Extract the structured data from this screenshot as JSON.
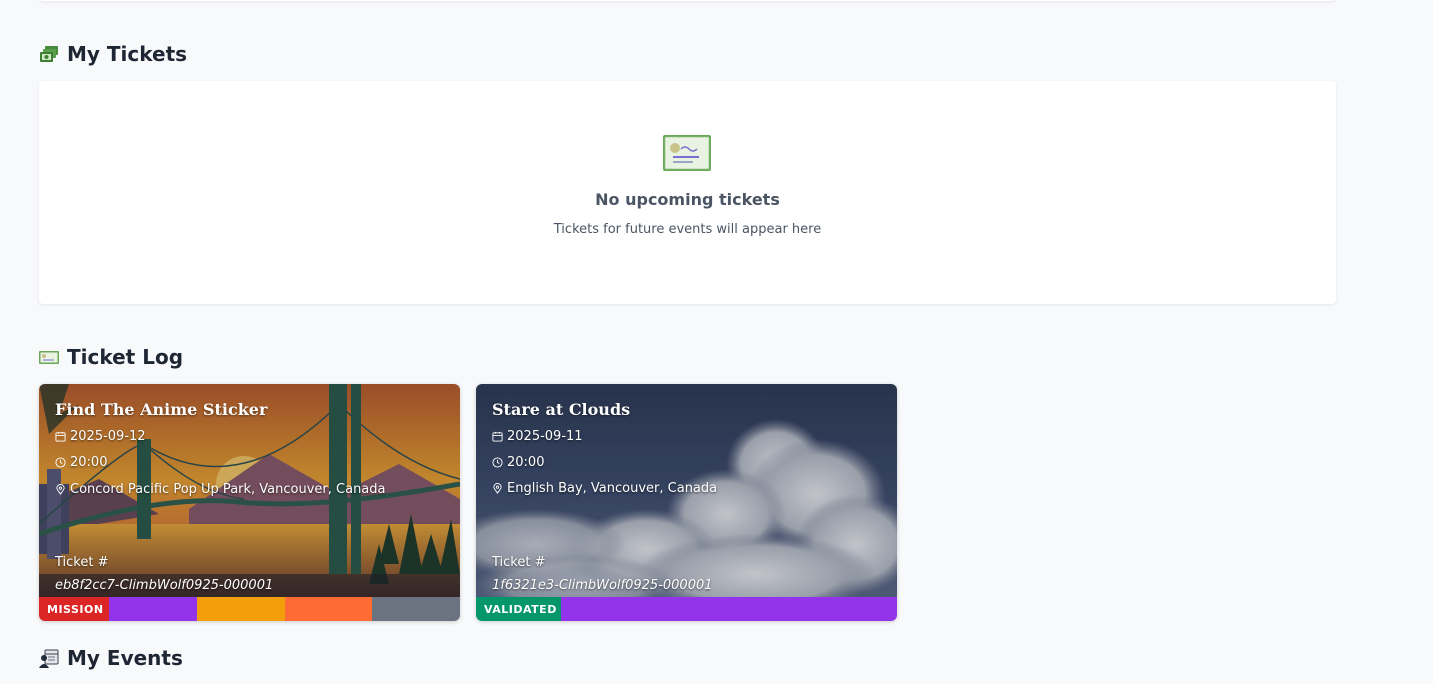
{
  "sections": {
    "my_tickets": {
      "title": "My Tickets",
      "icon": "tickets-stack-icon"
    },
    "ticket_log": {
      "title": "Ticket Log",
      "icon": "ticket-icon"
    },
    "my_events": {
      "title": "My Events",
      "icon": "calendar-person-icon"
    }
  },
  "empty_state": {
    "icon": "ticket-icon",
    "title": "No upcoming tickets",
    "subtitle": "Tickets for future events will appear here"
  },
  "ticket_log": [
    {
      "title": "Find The Anime Sticker",
      "date": "2025-09-12",
      "time": "20:00",
      "location": "Concord Pacific Pop Up Park, Vancouver, Canada",
      "ticket_label": "Ticket #",
      "ticket_number": "eb8f2cc7-ClimbWolf0925-000001",
      "badge": "MISSION",
      "badge_color": "#dc2626",
      "stripe_colors": [
        "#9333ea",
        "#f59e0b",
        "#ff6b35",
        "#6b7280"
      ]
    },
    {
      "title": "Stare at Clouds",
      "date": "2025-09-11",
      "time": "20:00",
      "location": "English Bay, Vancouver, Canada",
      "ticket_label": "Ticket #",
      "ticket_number": "1f6321e3-ClimbWolf0925-000001",
      "badge": "VALIDATED",
      "badge_color": "#059669",
      "stripe_colors": [
        "#9333ea"
      ]
    }
  ]
}
